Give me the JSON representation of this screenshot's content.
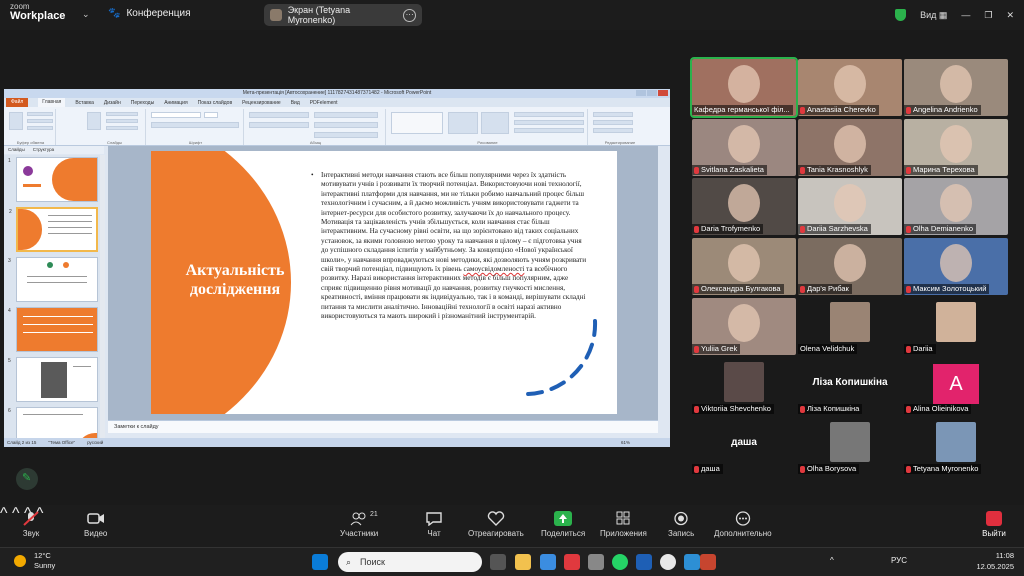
{
  "topbar": {
    "logo_top": "zoom",
    "logo_bottom": "Workplace",
    "meeting_label": "Конференция",
    "screen_label": "Экран (Tetyana Myronenko)",
    "view_label": "Вид",
    "shield_color": "#2bb24c"
  },
  "ppt": {
    "window_title": "Мета-презентація [Автосохранение] 1117827431487371482 - Microsoft PowerPoint",
    "tabs": [
      "Файл",
      "Главная",
      "Вставка",
      "Дизайн",
      "Переходы",
      "Анимация",
      "Показ слайдов",
      "Рецензирование",
      "Вид",
      "PDFelement"
    ],
    "ribbon_groups": [
      "Буфер обмена",
      "Слайды",
      "Шрифт",
      "Абзац",
      "Рисование",
      "Редактирование"
    ],
    "panel_tabs": [
      "Слайды",
      "Структура"
    ],
    "thumb_numbers": [
      "1",
      "2",
      "3",
      "4",
      "5",
      "6"
    ],
    "slide_title": "Актуальність дослідження",
    "slide_body_pre": "Інтерактивні методи навчання стають все більш популярними через їх здатність мотивувати учнів і розвивати їх творчий потенціал. Використовуючи нові технології, інтерактивні платформи для навчання, ми не тільки робимо навчальний процес більш технологічним і сучасним, а й даємо можливість учням використовувати гаджети та інтернет-ресурси для особистого розвитку, залучаючи їх до навчального процесу. Мотивація та зацікавленість учнів збільшується, коли навчання стає більш інтерактивним. На сучасному рівні освіти, на що зорієнтовано від таких соціальних установок, за якими головною метою уроку та навчання в цілому – є підготовка учня до успішного складання іспитів у майбутньому. За концепцією «Нової української школи», у навчання впроваджуються нові методики, які дозволяють учням розкривати свій творчий потенціал, підвищують їх рівень ",
    "slide_body_underlined": "самоусвідомленості",
    "slide_body_post": " та всебічного розвитку. Наразі використання інтерактивних методів є більш популярним, адже сприяє підвищенню рівня мотивації до навчання, розвитку гнучкості мислення, креативності, вміння працювати як індивідуально, так і в команді, вирішувати складні питання та мислити аналітично. Інноваційні технології в освіті наразі активно використовуються та мають широкий і різноманітний інструментарій.",
    "notes_placeholder": "Заметки к слайду",
    "status_slide": "Слайд 2 из 15",
    "status_theme": "\"Тема Office\"",
    "status_lang": "русский",
    "zoom_level": "61%",
    "accent_color": "#ee7b2e"
  },
  "participants": [
    {
      "name": "Кафедра германської філ...",
      "muted": false,
      "bg": "#a07060"
    },
    {
      "name": "Anastasiia Cherevko",
      "muted": true,
      "bg": "#a88670"
    },
    {
      "name": "Angelina Andrienko",
      "muted": true,
      "bg": "#9a8a7c"
    },
    {
      "name": "Svitlana Zaskalieta",
      "muted": true,
      "bg": "#9b8780"
    },
    {
      "name": "Tania Krasnoshlyk",
      "muted": true,
      "bg": "#8e7468"
    },
    {
      "name": "Марина Терехова",
      "muted": true,
      "bg": "#b8b0a2"
    },
    {
      "name": "Daria Trofymenko",
      "muted": true,
      "bg": "#514a46"
    },
    {
      "name": "Dariia Sarzhevska",
      "muted": true,
      "bg": "#c8c4be"
    },
    {
      "name": "Olha Demianenko",
      "muted": true,
      "bg": "#a5a3a6"
    },
    {
      "name": "Олександра Булгакова",
      "muted": true,
      "bg": "#9c8a78"
    },
    {
      "name": "Дар'я Рибак",
      "muted": true,
      "bg": "#7b6c60"
    },
    {
      "name": "Максим Золотоцький",
      "muted": true,
      "bg": "#4a6fa8"
    },
    {
      "name": "Yuliia Grek",
      "muted": true,
      "bg": "#a08a80"
    },
    {
      "name": "Olena Velidchuk",
      "muted": false,
      "bg": "#1a1a1a",
      "photo": "#9a8474"
    },
    {
      "name": "Dariia",
      "muted": true,
      "bg": "#1a1a1a",
      "photo": "#d0b29a"
    },
    {
      "name": "Viktoriia Shevchenko",
      "muted": true,
      "bg": "#1a1a1a",
      "photo": "#5a4a48"
    },
    {
      "name": "Ліза Копишкіна",
      "muted": true,
      "bg": "#1a1a1a",
      "center": "Ліза Копишкіна"
    },
    {
      "name": "Alina Olieinikova",
      "muted": true,
      "bg": "#1a1a1a",
      "avatar": "A"
    },
    {
      "name": "даша",
      "muted": true,
      "bg": "#1a1a1a",
      "center": "даша"
    },
    {
      "name": "Olha Borysova",
      "muted": true,
      "bg": "#1a1a1a",
      "photo": "#777777"
    },
    {
      "name": "Tetyana Myronenko",
      "muted": true,
      "bg": "#1a1a1a",
      "photo": "#7b96b6"
    }
  ],
  "toolbar": {
    "audio": "Звук",
    "video": "Видео",
    "participants": "Участники",
    "participants_count": "21",
    "chat": "Чат",
    "react": "Отреагировать",
    "share": "Поделиться",
    "apps": "Приложения",
    "record": "Запись",
    "more": "Дополнительно",
    "leave": "Выйти",
    "leave_color": "#e02f3e",
    "share_color": "#2bb24c"
  },
  "taskbar": {
    "temp": "12°C",
    "weather": "Sunny",
    "search": "Поиск",
    "lang": "РУС",
    "time": "11:08",
    "date": "12.05.2025"
  }
}
